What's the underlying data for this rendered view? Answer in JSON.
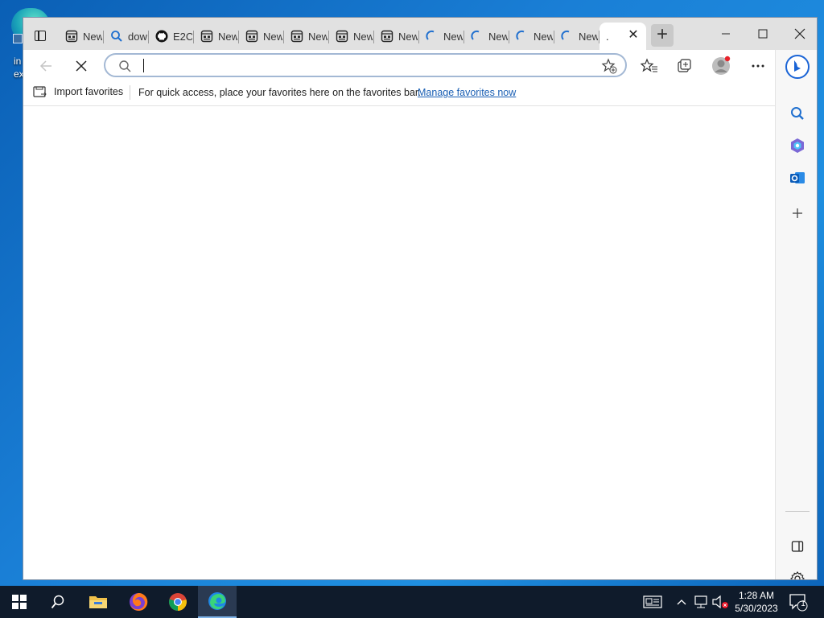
{
  "desktop": {
    "icon_text": "in\nex"
  },
  "browser": {
    "tabs": [
      {
        "label": "New tab",
        "icon": "newtab-page-icon"
      },
      {
        "label": "dow",
        "icon": "search-icon"
      },
      {
        "label": "E2C",
        "icon": "github-icon"
      },
      {
        "label": "New tab",
        "icon": "newtab-page-icon"
      },
      {
        "label": "New tab",
        "icon": "newtab-page-icon"
      },
      {
        "label": "New tab",
        "icon": "newtab-page-icon"
      },
      {
        "label": "New tab",
        "icon": "newtab-page-icon"
      },
      {
        "label": "New tab",
        "icon": "newtab-page-icon"
      },
      {
        "label": "New tab",
        "icon": "loading-spinner-icon"
      },
      {
        "label": "New tab",
        "icon": "loading-spinner-icon"
      },
      {
        "label": "New tab",
        "icon": "loading-spinner-icon"
      },
      {
        "label": "New tab",
        "icon": "loading-spinner-icon"
      }
    ],
    "active_tab": {
      "label": "."
    },
    "address": {
      "value": "",
      "placeholder": ""
    },
    "favorites_bar": {
      "import_label": "Import favorites",
      "message": "For quick access, place your favorites here on the favorites bar.",
      "manage_link": "Manage favorites now"
    }
  },
  "taskbar": {
    "time": "1:28 AM",
    "date": "5/30/2023",
    "notification_count": "1"
  },
  "colors": {
    "accent": "#1a5fb4",
    "taskbar": "#0f1b2b",
    "titlebar": "#e1e1e1"
  }
}
